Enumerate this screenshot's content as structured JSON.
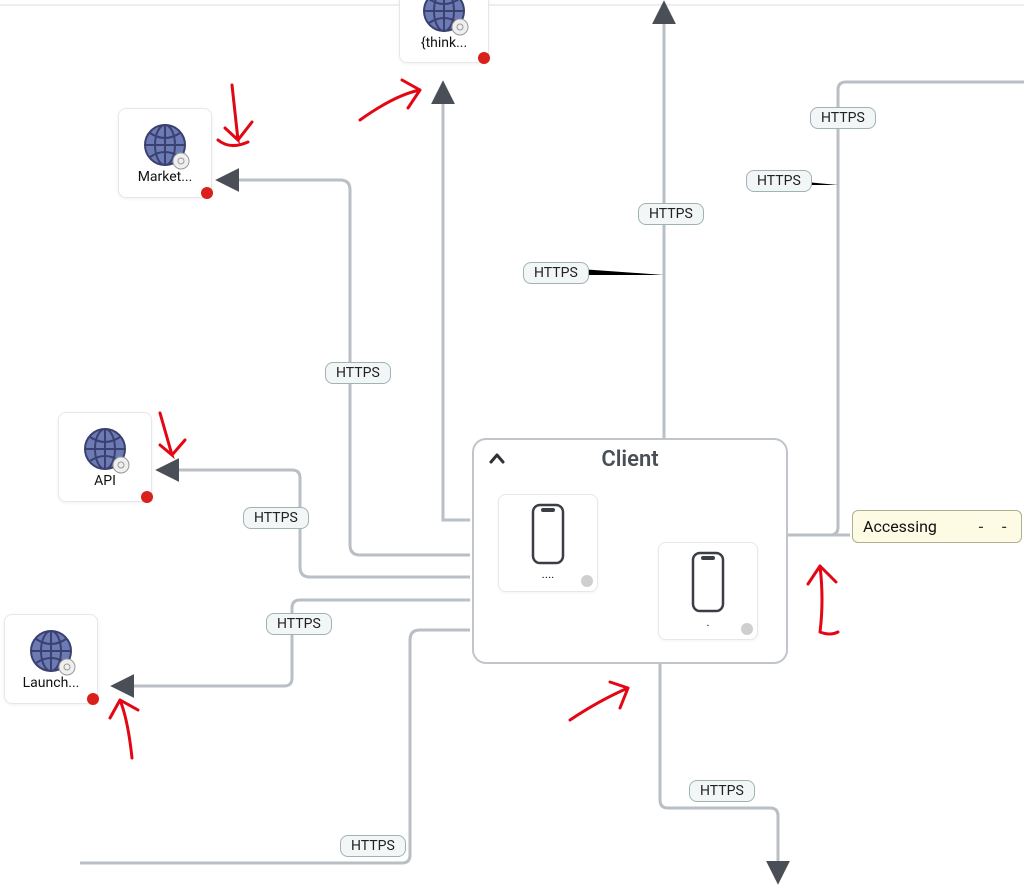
{
  "protocol_label": "HTTPS",
  "group": {
    "title": "Client",
    "device1_label": "....",
    "device2_label": "."
  },
  "nodes": {
    "think": {
      "label": "{think..."
    },
    "market": {
      "label": "Market..."
    },
    "api": {
      "label": "API"
    },
    "launch": {
      "label": "Launch..."
    }
  },
  "note": {
    "text": "Accessing",
    "trailing": "- -"
  },
  "colors": {
    "edge": "#b9bfc4",
    "arrow": "#4a4f57",
    "annotation": "#e30613",
    "globe": "#6d7bb5",
    "globe_stroke": "#3a4170"
  },
  "edge_pills": {
    "p1": "HTTPS",
    "p2": "HTTPS",
    "p3": "HTTPS",
    "p4": "HTTPS",
    "p5": "HTTPS",
    "p6": "HTTPS",
    "p7": "HTTPS",
    "p8": "HTTPS",
    "p9": "HTTPS"
  }
}
